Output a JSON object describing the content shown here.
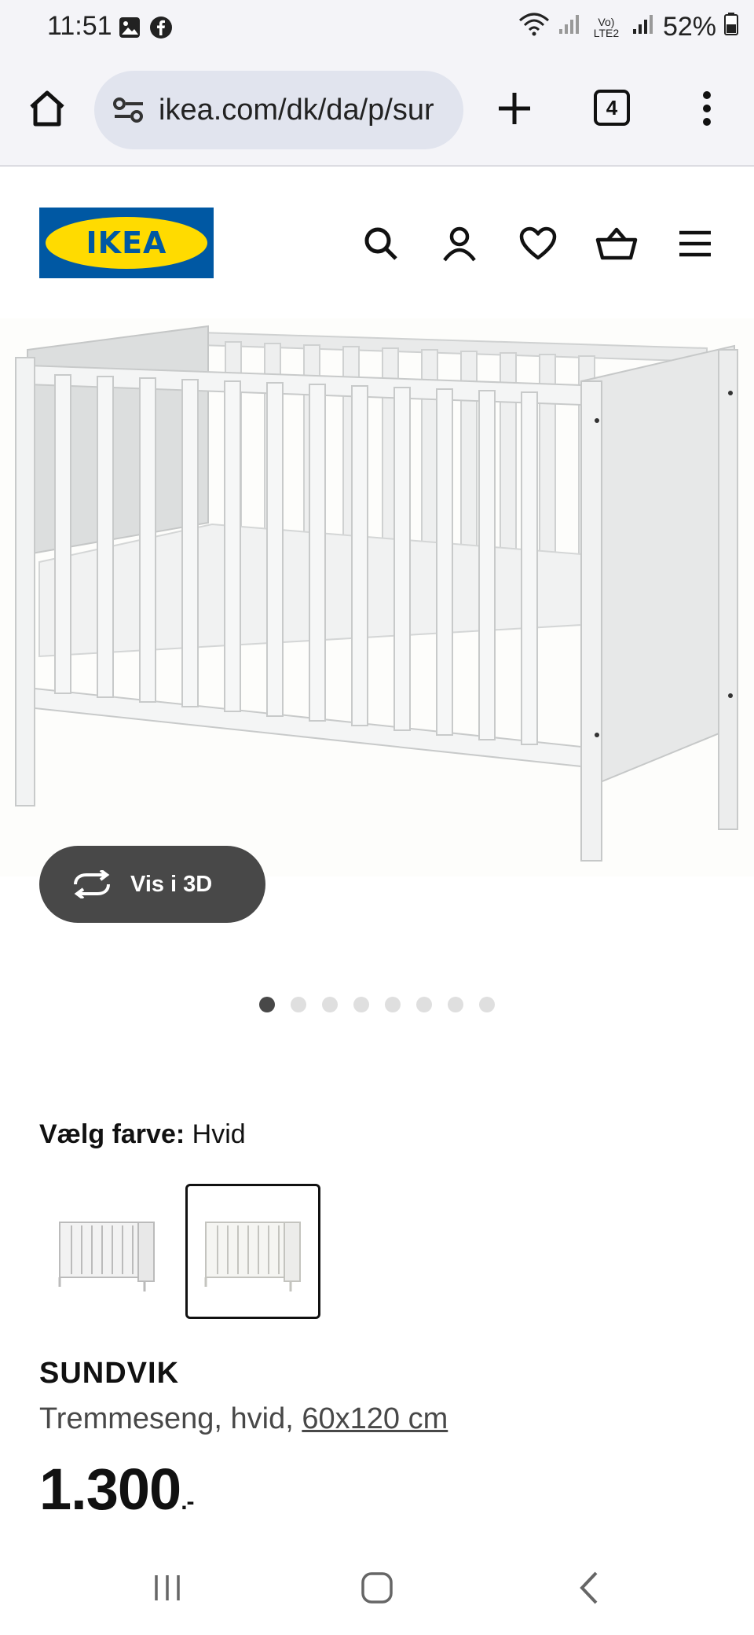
{
  "status_bar": {
    "time": "11:51",
    "battery": "52%",
    "network_label": "Vo) LTE2"
  },
  "browser": {
    "url": "ikea.com/dk/da/p/sur",
    "tab_count": "4"
  },
  "brand": {
    "logo_text": "IKEA"
  },
  "product": {
    "view_3d_label": "Vis i 3D",
    "image_count": 8,
    "active_image": 1,
    "color_label": "Vælg farve:",
    "color_value": "Hvid",
    "name": "SUNDVIK",
    "description": "Tremmeseng, hvid, ",
    "size": "60x120 cm",
    "price": "1.300",
    "price_suffix": ".-"
  },
  "colors": {
    "ikea_blue": "#0058a3",
    "ikea_yellow": "#ffdb00",
    "button_dark": "#484848"
  }
}
